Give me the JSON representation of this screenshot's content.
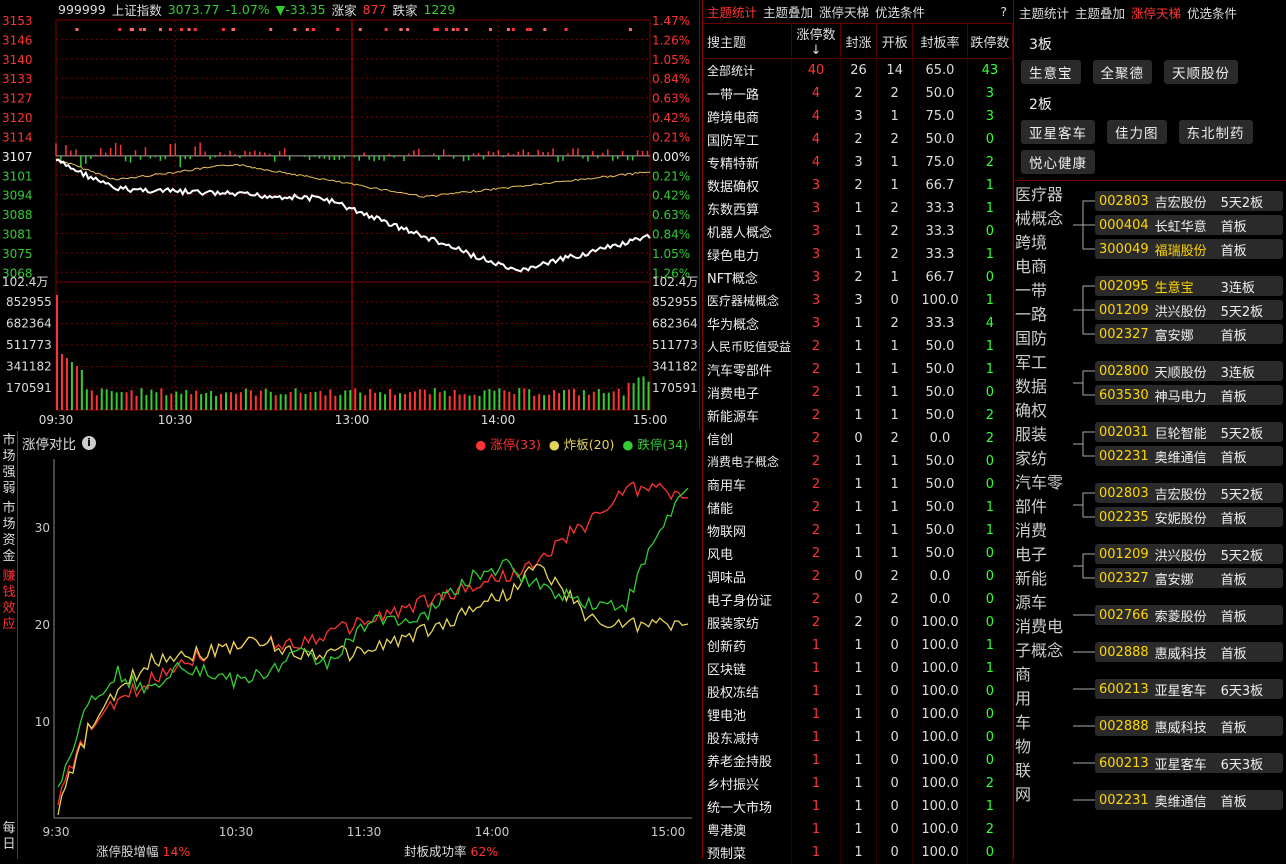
{
  "intraday": {
    "header": {
      "code": "999999",
      "name": "上证指数",
      "price": "3073.77",
      "pct": "-1.07%",
      "chg": "▼-33.35",
      "up_label": "涨家",
      "up_count": "877",
      "down_label": "跌家",
      "down_count": "1229"
    },
    "price_ticks": [
      "3153",
      "3146",
      "3140",
      "3133",
      "3127",
      "3120",
      "3114",
      "3107",
      "3101",
      "3094",
      "3088",
      "3081",
      "3075",
      "3068"
    ],
    "pct_ticks": [
      "1.47%",
      "1.26%",
      "1.05%",
      "0.84%",
      "0.63%",
      "0.42%",
      "0.21%",
      "0.00%",
      "0.21%",
      "0.42%",
      "0.63%",
      "0.84%",
      "1.05%",
      "1.26%"
    ],
    "vol_top": "102.4万",
    "vol_ticks": [
      "852955",
      "682364",
      "511773",
      "341182",
      "170591"
    ],
    "time_ticks": [
      "09:30",
      "10:30",
      "13:00",
      "14:00",
      "15:00"
    ],
    "colors": {
      "up": "#ff3333",
      "down": "#33cc33",
      "price_line": "#ffffff",
      "avg_line": "#e6c35a",
      "grid": "#800000"
    }
  },
  "compare": {
    "title": "涨停对比",
    "legend": [
      {
        "label": "涨停(33)",
        "color": "#ff3333"
      },
      {
        "label": "炸板(20)",
        "color": "#e6d45a"
      },
      {
        "label": "跌停(34)",
        "color": "#33cc33"
      }
    ],
    "side_tabs": [
      "市场强弱",
      "市场资金",
      "赚钱效应",
      "每日"
    ],
    "footer": [
      {
        "label": "涨停股增幅",
        "value": "14%"
      },
      {
        "label": "封板成功率",
        "value": "62%"
      }
    ],
    "chart_data": {
      "type": "line",
      "x_ticks": [
        "9:30",
        "10:30",
        "11:30",
        "14:00",
        "15:00"
      ],
      "y_ticks": [
        10,
        20,
        30
      ],
      "ylim": [
        0,
        37
      ],
      "series": [
        {
          "name": "涨停",
          "color": "#ff3333",
          "values": [
            2,
            9,
            12,
            14,
            16,
            17,
            18,
            18,
            18,
            19,
            20,
            21,
            22,
            23,
            24,
            25,
            26,
            29,
            31,
            34,
            34,
            33
          ]
        },
        {
          "name": "炸板",
          "color": "#e6d45a",
          "values": [
            1,
            9,
            13,
            16,
            17,
            17,
            18,
            18,
            17,
            17,
            17,
            18,
            19,
            20,
            22,
            23,
            26,
            23,
            20,
            20,
            20,
            20
          ]
        },
        {
          "name": "跌停",
          "color": "#33cc33",
          "values": [
            3,
            12,
            15,
            13,
            16,
            15,
            14,
            15,
            17,
            16,
            19,
            21,
            20,
            23,
            25,
            26,
            24,
            23,
            22,
            22,
            29,
            34
          ]
        }
      ]
    }
  },
  "sector": {
    "tabs": [
      {
        "label": "主题统计",
        "active": true
      },
      {
        "label": "主题叠加",
        "active": false
      },
      {
        "label": "涨停天梯",
        "active": false
      },
      {
        "label": "优选条件",
        "active": false
      },
      {
        "label": "?",
        "active": false
      }
    ],
    "headers": [
      "搜主题",
      "涨停数↓",
      "封涨",
      "开板",
      "封板率",
      "跌停数"
    ],
    "summary": {
      "name": "全部统计",
      "c1": "40",
      "c2": "26",
      "c3": "14",
      "c4": "65.0",
      "c6": "43"
    },
    "rows": [
      [
        "一带一路",
        "4",
        "2",
        "2",
        "50.0",
        "3"
      ],
      [
        "跨境电商",
        "4",
        "3",
        "1",
        "75.0",
        "3"
      ],
      [
        "国防军工",
        "4",
        "2",
        "2",
        "50.0",
        "0"
      ],
      [
        "专精特新",
        "4",
        "3",
        "1",
        "75.0",
        "2"
      ],
      [
        "数据确权",
        "3",
        "2",
        "1",
        "66.7",
        "1"
      ],
      [
        "东数西算",
        "3",
        "1",
        "2",
        "33.3",
        "1"
      ],
      [
        "机器人概念",
        "3",
        "1",
        "2",
        "33.3",
        "0"
      ],
      [
        "绿色电力",
        "3",
        "1",
        "2",
        "33.3",
        "1"
      ],
      [
        "NFT概念",
        "3",
        "2",
        "1",
        "66.7",
        "0"
      ],
      [
        "医疗器械概念",
        "3",
        "3",
        "0",
        "100.0",
        "1"
      ],
      [
        "华为概念",
        "3",
        "1",
        "2",
        "33.3",
        "4"
      ],
      [
        "人民币贬值受益",
        "2",
        "1",
        "1",
        "50.0",
        "1"
      ],
      [
        "汽车零部件",
        "2",
        "1",
        "1",
        "50.0",
        "1"
      ],
      [
        "消费电子",
        "2",
        "1",
        "1",
        "50.0",
        "0"
      ],
      [
        "新能源车",
        "2",
        "1",
        "1",
        "50.0",
        "2"
      ],
      [
        "信创",
        "2",
        "0",
        "2",
        "0.0",
        "2"
      ],
      [
        "消费电子概念",
        "2",
        "1",
        "1",
        "50.0",
        "0"
      ],
      [
        "商用车",
        "2",
        "1",
        "1",
        "50.0",
        "0"
      ],
      [
        "储能",
        "2",
        "1",
        "1",
        "50.0",
        "1"
      ],
      [
        "物联网",
        "2",
        "1",
        "1",
        "50.0",
        "1"
      ],
      [
        "风电",
        "2",
        "1",
        "1",
        "50.0",
        "0"
      ],
      [
        "调味品",
        "2",
        "0",
        "2",
        "0.0",
        "0"
      ],
      [
        "电子身份证",
        "2",
        "0",
        "2",
        "0.0",
        "0"
      ],
      [
        "服装家纺",
        "2",
        "2",
        "0",
        "100.0",
        "0"
      ],
      [
        "创新药",
        "1",
        "1",
        "0",
        "100.0",
        "1"
      ],
      [
        "区块链",
        "1",
        "1",
        "0",
        "100.0",
        "1"
      ],
      [
        "股权冻结",
        "1",
        "1",
        "0",
        "100.0",
        "0"
      ],
      [
        "锂电池",
        "1",
        "1",
        "0",
        "100.0",
        "0"
      ],
      [
        "股东减持",
        "1",
        "1",
        "0",
        "100.0",
        "0"
      ],
      [
        "养老金持股",
        "1",
        "1",
        "0",
        "100.0",
        "0"
      ],
      [
        "乡村振兴",
        "1",
        "1",
        "0",
        "100.0",
        "2"
      ],
      [
        "统一大市场",
        "1",
        "1",
        "0",
        "100.0",
        "1"
      ],
      [
        "粤港澳",
        "1",
        "1",
        "0",
        "100.0",
        "2"
      ],
      [
        "预制菜",
        "1",
        "1",
        "0",
        "100.0",
        "0"
      ]
    ]
  },
  "ladder": {
    "tabs": [
      {
        "label": "主题统计",
        "active": false
      },
      {
        "label": "主题叠加",
        "active": false
      },
      {
        "label": "涨停天梯",
        "active": true
      },
      {
        "label": "优选条件",
        "active": false
      }
    ],
    "boards": [
      {
        "title": "3板",
        "stocks": [
          "生意宝",
          "全聚德",
          "天顺股份"
        ]
      },
      {
        "title": "2板",
        "stocks": [
          "亚星客车",
          "佳力图",
          "东北制药",
          "悦心健康"
        ]
      }
    ],
    "groups": [
      {
        "label": "医疗器械概念",
        "items": [
          [
            "002803",
            "吉宏股份",
            "5天2板",
            false
          ],
          [
            "000404",
            "长虹华意",
            "首板",
            false
          ],
          [
            "300049",
            "福瑞股份",
            "首板",
            true
          ]
        ]
      },
      {
        "label": "跨境电商",
        "items": [
          [
            "002095",
            "生意宝",
            "3连板",
            true
          ],
          [
            "001209",
            "洪兴股份",
            "5天2板",
            false
          ],
          [
            "002327",
            "富安娜",
            "首板",
            false
          ]
        ]
      },
      {
        "label": "一带一路",
        "items": [
          [
            "002800",
            "天顺股份",
            "3连板",
            false
          ],
          [
            "603530",
            "神马电力",
            "首板",
            false
          ]
        ]
      },
      {
        "label": "国防军工",
        "items": [
          [
            "002031",
            "巨轮智能",
            "5天2板",
            false
          ],
          [
            "002231",
            "奥维通信",
            "首板",
            false
          ]
        ]
      },
      {
        "label": "数据确权",
        "items": [
          [
            "002803",
            "吉宏股份",
            "5天2板",
            false
          ],
          [
            "002235",
            "安妮股份",
            "首板",
            false
          ]
        ]
      },
      {
        "label": "服装家纺",
        "items": [
          [
            "001209",
            "洪兴股份",
            "5天2板",
            false
          ],
          [
            "002327",
            "富安娜",
            "首板",
            false
          ]
        ]
      },
      {
        "label": "汽车零部件",
        "items": [
          [
            "002766",
            "索菱股份",
            "首板",
            false
          ]
        ]
      },
      {
        "label": "消费电子",
        "items": [
          [
            "002888",
            "惠威科技",
            "首板",
            false
          ]
        ]
      },
      {
        "label": "新能源车",
        "items": [
          [
            "600213",
            "亚星客车",
            "6天3板",
            false
          ]
        ]
      },
      {
        "label": "消费电子概念",
        "items": [
          [
            "002888",
            "惠威科技",
            "首板",
            false
          ]
        ]
      },
      {
        "label": "商用车",
        "items": [
          [
            "600213",
            "亚星客车",
            "6天3板",
            false
          ]
        ]
      },
      {
        "label": "物联网",
        "items": [
          [
            "002231",
            "奥维通信",
            "首板",
            false
          ]
        ]
      }
    ]
  }
}
